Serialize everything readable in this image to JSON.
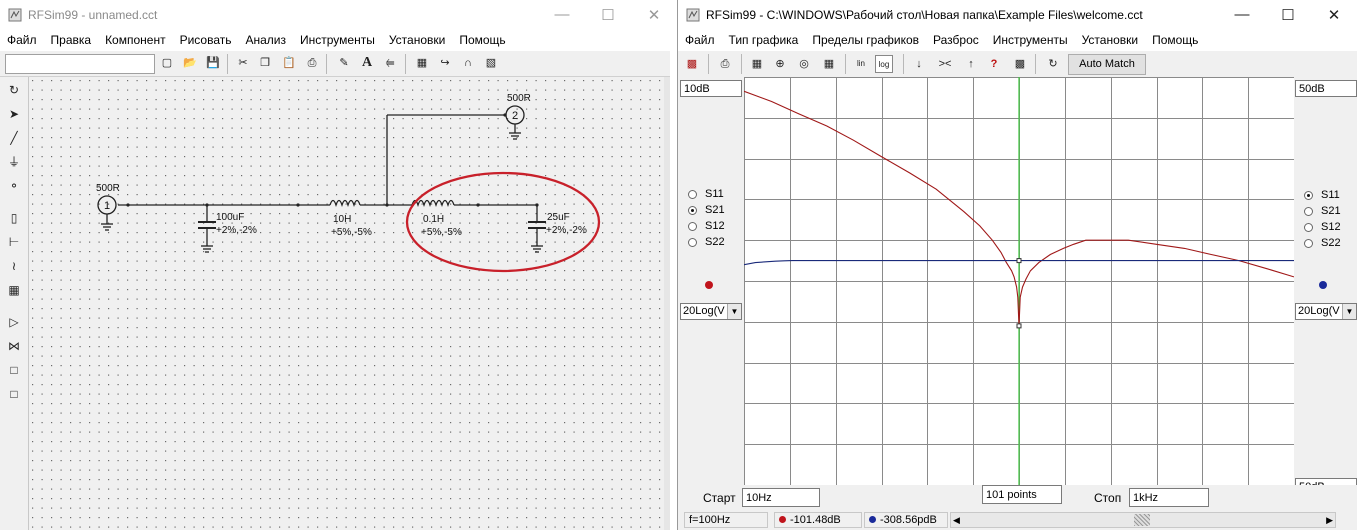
{
  "left_window": {
    "title": "RFSim99 - unnamed.cct",
    "menu": [
      "Файл",
      "Правка",
      "Компонент",
      "Рисовать",
      "Анализ",
      "Инструменты",
      "Установки",
      "Помощь"
    ],
    "schematic": {
      "port1_res": "500R",
      "port1_num": "1",
      "port2_res": "500R",
      "port2_num": "2",
      "c1_value": "100uF",
      "c1_tol": "+2%,-2%",
      "l1_value": "10H",
      "l1_tol": "+5%,-5%",
      "l2_value": "0.1H",
      "l2_tol": "+5%,-5%",
      "c2_value": "25uF",
      "c2_tol": "+2%,-2%",
      "highlight_color": "#c8202a"
    }
  },
  "right_window": {
    "title": "RFSim99 - C:\\WINDOWS\\Рабочий стол\\Новая папка\\Example Files\\welcome.cct",
    "menu": [
      "Файл",
      "Тип графика",
      "Пределы графиков",
      "Разброс",
      "Инструменты",
      "Установки",
      "Помощь"
    ],
    "auto_match_label": "Auto Match",
    "left_scale_top": "10dB",
    "right_scale_top": "50dB",
    "right_scale_bottom": "50dB",
    "left_params": [
      {
        "label": "S11",
        "selected": false
      },
      {
        "label": "S21",
        "selected": true
      },
      {
        "label": "S12",
        "selected": false
      },
      {
        "label": "S22",
        "selected": false
      }
    ],
    "right_params": [
      {
        "label": "S11",
        "selected": true
      },
      {
        "label": "S21",
        "selected": false
      },
      {
        "label": "S12",
        "selected": false
      },
      {
        "label": "S22",
        "selected": false
      }
    ],
    "left_trace_color": "#c0141c",
    "right_trace_color": "#1a2a9a",
    "left_format": "20Log(V",
    "right_format": "20Log(V",
    "start_label": "Старт",
    "start_value": "10Hz",
    "points_value": "101 points",
    "stop_label": "Стоп",
    "stop_value": "1kHz",
    "status": {
      "freq": "f=100Hz",
      "marker1": "-101.48dB",
      "marker2": "-308.56pdB"
    }
  },
  "chart_data": {
    "type": "line",
    "x_scale": "log",
    "xlim": [
      10,
      1000
    ],
    "grid": true,
    "marker_x": 100,
    "series": [
      {
        "color": "#a01818",
        "x": [
          10,
          12.6,
          15.8,
          20,
          25,
          31.6,
          40,
          50,
          63,
          72,
          80,
          86,
          90,
          94,
          96,
          98,
          99,
          100,
          101,
          103,
          106,
          110,
          118,
          130,
          145,
          158,
          175,
          200,
          250,
          316,
          400,
          500,
          631,
          800,
          1000
        ],
        "y": [
          0.93,
          0.88,
          0.82,
          0.76,
          0.69,
          0.61,
          0.53,
          0.45,
          0.34,
          0.27,
          0.2,
          0.14,
          0.09,
          0.05,
          0.02,
          -0.03,
          -0.08,
          -0.22,
          -0.08,
          -0.03,
          0.01,
          0.05,
          0.09,
          0.13,
          0.16,
          0.18,
          0.2,
          0.2,
          0.2,
          0.18,
          0.16,
          0.13,
          0.1,
          0.06,
          0.02
        ]
      },
      {
        "color": "#1a2a7a",
        "x": [
          10,
          11,
          12,
          13,
          14,
          15,
          16,
          17,
          18,
          20,
          25,
          40,
          63,
          100,
          158,
          251,
          400,
          631,
          1000
        ],
        "y": [
          0.08,
          0.09,
          0.094,
          0.097,
          0.099,
          0.1,
          0.1,
          0.1,
          0.1,
          0.1,
          0.1,
          0.1,
          0.1,
          0.1,
          0.1,
          0.1,
          0.1,
          0.1,
          0.1
        ]
      }
    ]
  }
}
